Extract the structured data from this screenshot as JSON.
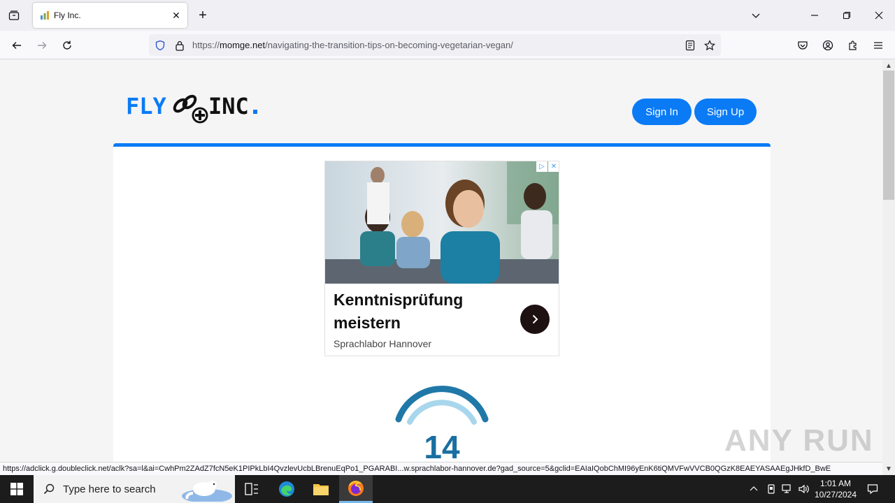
{
  "browser": {
    "tab_title": "Fly Inc.",
    "url_prefix": "https://",
    "url_host": "momge.net",
    "url_path": "/navigating-the-transition-tips-on-becoming-vegetarian-vegan/"
  },
  "header": {
    "sign_in_label": "Sign In",
    "sign_up_label": "Sign Up"
  },
  "ad": {
    "title": "Kenntnisprüfung meistern",
    "advertiser": "Sprachlabor Hannover"
  },
  "counter": {
    "value": "14"
  },
  "status_url": "https://adclick.g.doubleclick.net/aclk?sa=l&ai=CwhPm2ZAdZ7fcN5eK1PIPkLbI4QvzlevUcbLBrenuEqPo1_PGARABI...w.sprachlabor-hannover.de?gad_source=5&gclid=EAIaIQobChMI96yEnK6tiQMVFwVVCB0QGzK8EAEYASAAEgJHkfD_BwE",
  "watermark": "ANY RUN",
  "taskbar": {
    "search_placeholder": "Type here to search",
    "time": "1:01 AM",
    "date": "10/27/2024"
  },
  "colors": {
    "brand_blue": "#0a7bf5",
    "counter_blue": "#1a6fa0"
  }
}
